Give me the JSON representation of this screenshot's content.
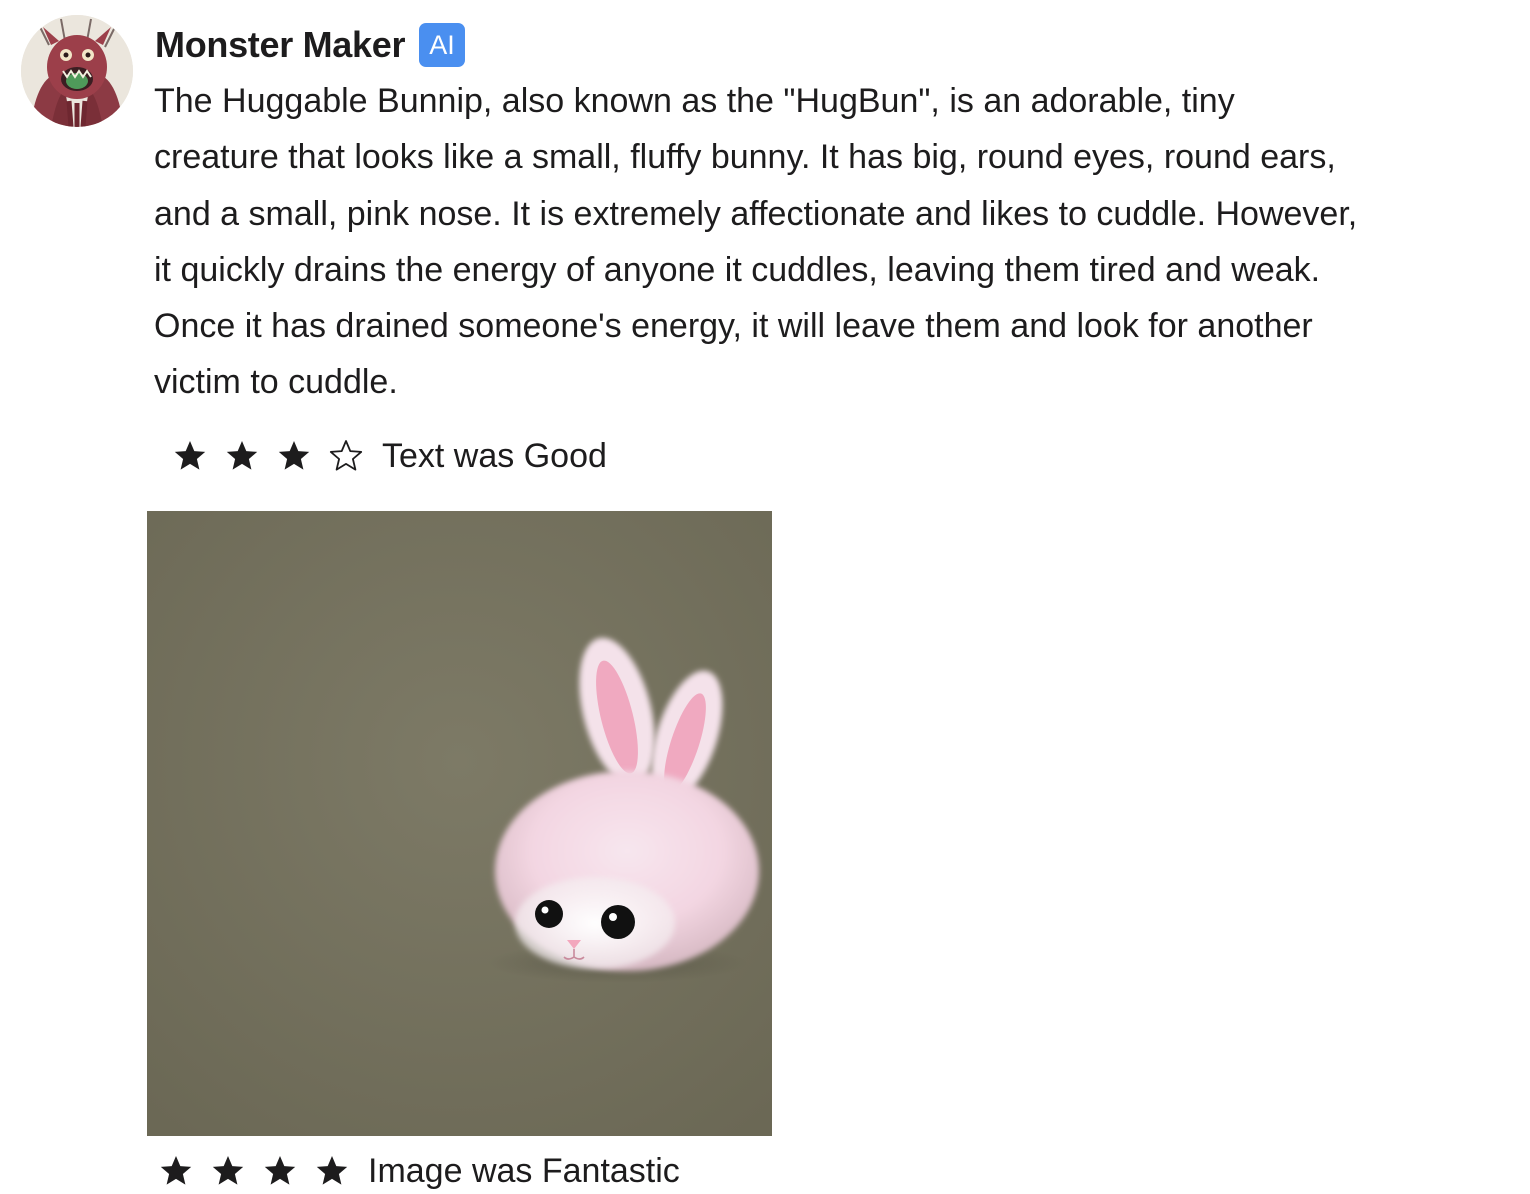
{
  "message": {
    "sender_name": "Monster Maker",
    "badge": "AI",
    "avatar_icon": "monster-avatar",
    "text_lines": [
      "The Huggable Bunnip, also known as the \"HugBun\", is an adorable, tiny",
      "creature that looks like a small, fluffy bunny. It has big, round eyes, round ears,",
      "and a small, pink nose. It is extremely affectionate and likes to cuddle. However,",
      "it quickly drains the energy of anyone it cuddles, leaving them tired and weak.",
      "Once it has drained someone's energy, it will leave them and look for another",
      "victim to cuddle."
    ]
  },
  "text_rating": {
    "stars_filled": 3,
    "stars_total": 4,
    "label": "Text was Good"
  },
  "generated_image": {
    "icon": "fluffy-bunny-image",
    "background_color": "#76735f"
  },
  "image_rating": {
    "stars_filled": 4,
    "stars_total": 4,
    "label": "Image was Fantastic"
  },
  "colors": {
    "badge": "#4a8ff0",
    "text": "#1d1c1d"
  }
}
